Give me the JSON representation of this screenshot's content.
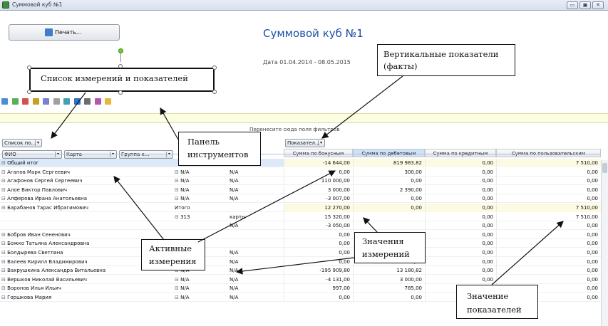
{
  "window": {
    "title": "Суммовой куб №1",
    "controls": {
      "minimize": "▭",
      "maximize": "▣",
      "close": "✕"
    }
  },
  "report": {
    "print_label": "Печать...",
    "cube_title": "Суммовой куб №1",
    "date_range": "Дата 01.04.2014 - 08.05.2015"
  },
  "filter_area": {
    "hint": "Перенесите сюда поля фильтров"
  },
  "dimension_chips": {
    "list_button": "Список по...",
    "indicators_button": "Показател...",
    "fio": "ФИО",
    "card": "Карта",
    "group": "Группа к..."
  },
  "columns": [
    "Сумма по бонусным",
    "Сумма по дебетовым",
    "Сумма по кредитным",
    "Сумма по пользовательским"
  ],
  "rows": [
    {
      "name": "Общий итог",
      "card": "",
      "group": "",
      "v1": "-14 644,00",
      "v2": "819 983,82",
      "v3": "0,00",
      "v4": "7 510,00",
      "total": true
    },
    {
      "name": "Агапов Марк Сергеевич",
      "card": "N/A",
      "group": "N/A",
      "v1": "0,00",
      "v2": "300,00",
      "v3": "0,00",
      "v4": "0,00"
    },
    {
      "name": "Агафонов Сергей Сергеевич",
      "card": "N/A",
      "group": "N/A",
      "v1": "110 000,00",
      "v2": "0,00",
      "v3": "0,00",
      "v4": "0,00"
    },
    {
      "name": "Алое Виктор Павлович",
      "card": "N/A",
      "group": "N/A",
      "v1": "3 000,00",
      "v2": "2 390,00",
      "v3": "0,00",
      "v4": "0,00"
    },
    {
      "name": "Алферова Ирана Анатольевна",
      "card": "N/A",
      "group": "N/A",
      "v1": "-3 007,00",
      "v2": "0,00",
      "v3": "0,00",
      "v4": "0,00"
    },
    {
      "name": "Барабанов Тарас Ибрагимович",
      "card": "Итого",
      "group": "",
      "v1": "12 270,00",
      "v2": "0,00",
      "v3": "0,00",
      "v4": "7 510,00",
      "subtotal": true
    },
    {
      "name": "",
      "card": "313",
      "group": "карты",
      "v1": "15 320,00",
      "v2": "",
      "v3": "0,00",
      "v4": "7 510,00"
    },
    {
      "name": "",
      "card": "",
      "group": "N/A",
      "v1": "-3 050,00",
      "v2": "",
      "v3": "0,00",
      "v4": "0,00"
    },
    {
      "name": "Бобров Иван Сененович",
      "card": "",
      "group": "",
      "v1": "0,00",
      "v2": "",
      "v3": "0,00",
      "v4": "0,00"
    },
    {
      "name": "Божко Татьяна Александровна",
      "card": "N/A",
      "group": "",
      "v1": "0,00",
      "v2": "",
      "v3": "0,00",
      "v4": "0,00"
    },
    {
      "name": "Болдырева Светлана",
      "card": "",
      "group": "N/A",
      "v1": "0,00",
      "v2": "0,00",
      "v3": "0,00",
      "v4": "0,00"
    },
    {
      "name": "Валеев Кирилл Владимирович",
      "card": "N/A",
      "group": "N/A",
      "v1": "0,00",
      "v2": "800,00",
      "v3": "0,00",
      "v4": "0,00"
    },
    {
      "name": "Вахрушкина Александра Витальевна",
      "card": "N/A",
      "group": "N/A",
      "v1": "-195 909,80",
      "v2": "13 180,82",
      "v3": "0,00",
      "v4": "0,00"
    },
    {
      "name": "Вершков Николай Васильевич",
      "card": "N/A",
      "group": "N/A",
      "v1": "-4 131,00",
      "v2": "3 000,00",
      "v3": "0,00",
      "v4": "0,00"
    },
    {
      "name": "Воронов Илья Ильич",
      "card": "N/A",
      "group": "N/A",
      "v1": "997,00",
      "v2": "785,00",
      "v3": "0,00",
      "v4": "0,00"
    },
    {
      "name": "Горшкова Мария",
      "card": "N/A",
      "group": "N/A",
      "v1": "0,00",
      "v2": "0,00",
      "v3": "0,00",
      "v4": "0,00"
    }
  ],
  "callouts": {
    "measures_list": "Список измерений  и показателей",
    "vertical_line1": "Вертикальные показатели",
    "vertical_line2": "(факты)",
    "toolbar_line1": "Панель",
    "toolbar_line2": "инструментов",
    "active_line1": "Активные",
    "active_line2": "измерения",
    "dim_values_line1": "Значения",
    "dim_values_line2": "измерений",
    "ind_values_line1": "Значение",
    "ind_values_line2": "показателей"
  }
}
